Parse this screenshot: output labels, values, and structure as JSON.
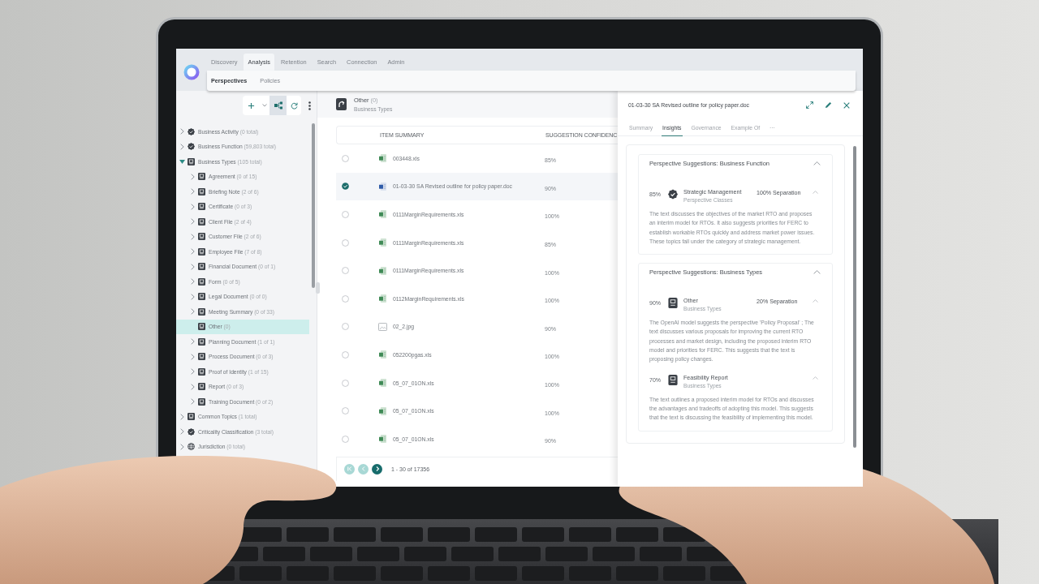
{
  "nav": {
    "tabs": [
      {
        "label": "Discovery",
        "selected": false
      },
      {
        "label": "Analysis",
        "selected": true
      },
      {
        "label": "Retention",
        "selected": false
      },
      {
        "label": "Search",
        "selected": false
      },
      {
        "label": "Connection",
        "selected": false
      },
      {
        "label": "Admin",
        "selected": false
      }
    ],
    "subtabs": [
      {
        "label": "Perspectives",
        "selected": true
      },
      {
        "label": "Policies",
        "selected": false
      }
    ]
  },
  "tree_toolbar": [
    {
      "kind": "add",
      "selected": false
    },
    {
      "kind": "dropdown",
      "selected": false
    },
    {
      "kind": "hierarchy",
      "selected": true
    },
    {
      "kind": "refresh",
      "selected": false
    },
    {
      "kind": "more",
      "selected": false
    }
  ],
  "tree": [
    {
      "label": "Business Activity",
      "count": "(0 total)",
      "kind": "badge",
      "expandable": true,
      "expanded": false,
      "selected": false
    },
    {
      "label": "Business Function",
      "count": "(59,803 total)",
      "kind": "badge",
      "expandable": true,
      "expanded": false,
      "selected": false
    },
    {
      "label": "Business Types",
      "count": "(105 total)",
      "kind": "tile",
      "expandable": true,
      "expanded": true,
      "selected": false,
      "children": [
        {
          "label": "Agreement",
          "count": "(0 of 15)",
          "kind": "tile",
          "expandable": true,
          "expanded": false,
          "selected": false
        },
        {
          "label": "Briefing Note",
          "count": "(2 of 6)",
          "kind": "tile",
          "expandable": true,
          "expanded": false,
          "selected": false
        },
        {
          "label": "Certificate",
          "count": "(0 of 3)",
          "kind": "tile",
          "expandable": true,
          "expanded": false,
          "selected": false
        },
        {
          "label": "Client File",
          "count": "(2 of 4)",
          "kind": "tile",
          "expandable": true,
          "expanded": false,
          "selected": false
        },
        {
          "label": "Customer File",
          "count": "(2 of 6)",
          "kind": "tile",
          "expandable": true,
          "expanded": false,
          "selected": false
        },
        {
          "label": "Employee File",
          "count": "(7 of 8)",
          "kind": "tile",
          "expandable": true,
          "expanded": false,
          "selected": false
        },
        {
          "label": "Financial Document",
          "count": "(0 of 1)",
          "kind": "tile",
          "expandable": true,
          "expanded": false,
          "selected": false
        },
        {
          "label": "Form",
          "count": "(0 of 5)",
          "kind": "tile",
          "expandable": true,
          "expanded": false,
          "selected": false
        },
        {
          "label": "Legal Document",
          "count": "(0 of 0)",
          "kind": "tile",
          "expandable": true,
          "expanded": false,
          "selected": false
        },
        {
          "label": "Meeting Summary",
          "count": "(0 of 33)",
          "kind": "tile",
          "expandable": true,
          "expanded": false,
          "selected": false
        },
        {
          "label": "Other",
          "count": "(0)",
          "kind": "tile",
          "expandable": false,
          "selected": true
        },
        {
          "label": "Planning Document",
          "count": "(1 of 1)",
          "kind": "tile",
          "expandable": true,
          "expanded": false,
          "selected": false
        },
        {
          "label": "Process Document",
          "count": "(0 of 3)",
          "kind": "tile",
          "expandable": true,
          "expanded": false,
          "selected": false
        },
        {
          "label": "Proof of Identity",
          "count": "(1 of 15)",
          "kind": "tile",
          "expandable": true,
          "expanded": false,
          "selected": false
        },
        {
          "label": "Report",
          "count": "(0 of 3)",
          "kind": "tile",
          "expandable": true,
          "expanded": false,
          "selected": false
        },
        {
          "label": "Training Document",
          "count": "(0 of 2)",
          "kind": "tile",
          "expandable": true,
          "expanded": false,
          "selected": false
        }
      ]
    },
    {
      "label": "Common Topics",
      "count": "(1 total)",
      "kind": "tile",
      "expandable": true,
      "expanded": false,
      "selected": false
    },
    {
      "label": "Criticality Classification",
      "count": "(3 total)",
      "kind": "badge",
      "expandable": true,
      "expanded": false,
      "selected": false
    },
    {
      "label": "Jurisdiction",
      "count": "(0 total)",
      "kind": "globe",
      "expandable": true,
      "expanded": false,
      "selected": false
    }
  ],
  "list": {
    "header": {
      "title": "Other",
      "count": "(0)",
      "subtitle": "Business Types"
    },
    "columns": [
      "ITEM SUMMARY",
      "SUGGESTION CONFIDENC"
    ],
    "rows": [
      {
        "name": "003448.xls",
        "confidence": "85%",
        "kind": "spreadsheet",
        "selected": false
      },
      {
        "name": "01-03-30 SA Revised outline for policy paper.doc",
        "confidence": "90%",
        "kind": "document",
        "selected": true
      },
      {
        "name": "0111MarginRequirements.xls",
        "confidence": "100%",
        "kind": "spreadsheet",
        "selected": false
      },
      {
        "name": "0111MarginRequirements.xls",
        "confidence": "85%",
        "kind": "spreadsheet",
        "selected": false
      },
      {
        "name": "0111MarginRequirements.xls",
        "confidence": "100%",
        "kind": "spreadsheet",
        "selected": false
      },
      {
        "name": "0112MarginRequirements.xls",
        "confidence": "100%",
        "kind": "spreadsheet",
        "selected": false
      },
      {
        "name": "02_2.jpg",
        "confidence": "90%",
        "kind": "image",
        "selected": false
      },
      {
        "name": "052200pgas.xls",
        "confidence": "100%",
        "kind": "spreadsheet",
        "selected": false
      },
      {
        "name": "05_07_01ON.xls",
        "confidence": "100%",
        "kind": "spreadsheet",
        "selected": false
      },
      {
        "name": "05_07_01ON.xls",
        "confidence": "100%",
        "kind": "spreadsheet",
        "selected": false
      },
      {
        "name": "05_07_01ON.xls",
        "confidence": "90%",
        "kind": "spreadsheet",
        "selected": false
      }
    ],
    "pagination": {
      "buttons": [
        {
          "kind": "first",
          "disabled": true
        },
        {
          "kind": "previous",
          "disabled": true
        },
        {
          "kind": "next",
          "disabled": false
        }
      ],
      "range": "1 - 30 of 17356"
    }
  },
  "detail": {
    "title": "01-03-30 SA Revised outline for policy paper.doc",
    "tabs": [
      {
        "label": "Summary",
        "selected": false
      },
      {
        "label": "Insights",
        "selected": true
      },
      {
        "label": "Governance",
        "selected": false
      },
      {
        "label": "Example Of",
        "selected": false
      },
      {
        "label": "···",
        "selected": false
      }
    ],
    "sections": [
      {
        "title": "Perspective Suggestions: Business Function",
        "expanded": true,
        "suggestions": [
          {
            "confidence": "85%",
            "kind": "badge",
            "name": "Strategic Management",
            "category": "Perspective Classes",
            "separation": "100% Separation",
            "expanded": true,
            "text": "The text discusses the objectives of the market RTO and proposes an interim model for RTOs. It also suggests priorities for FERC to establish workable RTOs quickly and address market power issues. These topics fall under the category of strategic management."
          }
        ]
      },
      {
        "title": "Perspective Suggestions: Business Types",
        "expanded": true,
        "suggestions": [
          {
            "confidence": "90%",
            "kind": "tile",
            "name": "Other",
            "category": "Business Types",
            "separation": "20% Separation",
            "expanded": true,
            "text": "The OpenAI model suggests the perspective 'Policy Proposal' ; The text discusses various proposals for improving the current RTO processes and market design, including the proposed interim RTO model and priorities for FERC. This suggests that the text is proposing policy changes."
          },
          {
            "confidence": "70%",
            "kind": "tile",
            "name": "Feasibility Report",
            "category": "Business Types",
            "expanded": true,
            "text": "The text outlines a proposed interim model for RTOs and discusses the advantages and tradeoffs of adopting this model. This suggests that the text is discussing the feasibility of implementing this model."
          }
        ]
      }
    ]
  }
}
